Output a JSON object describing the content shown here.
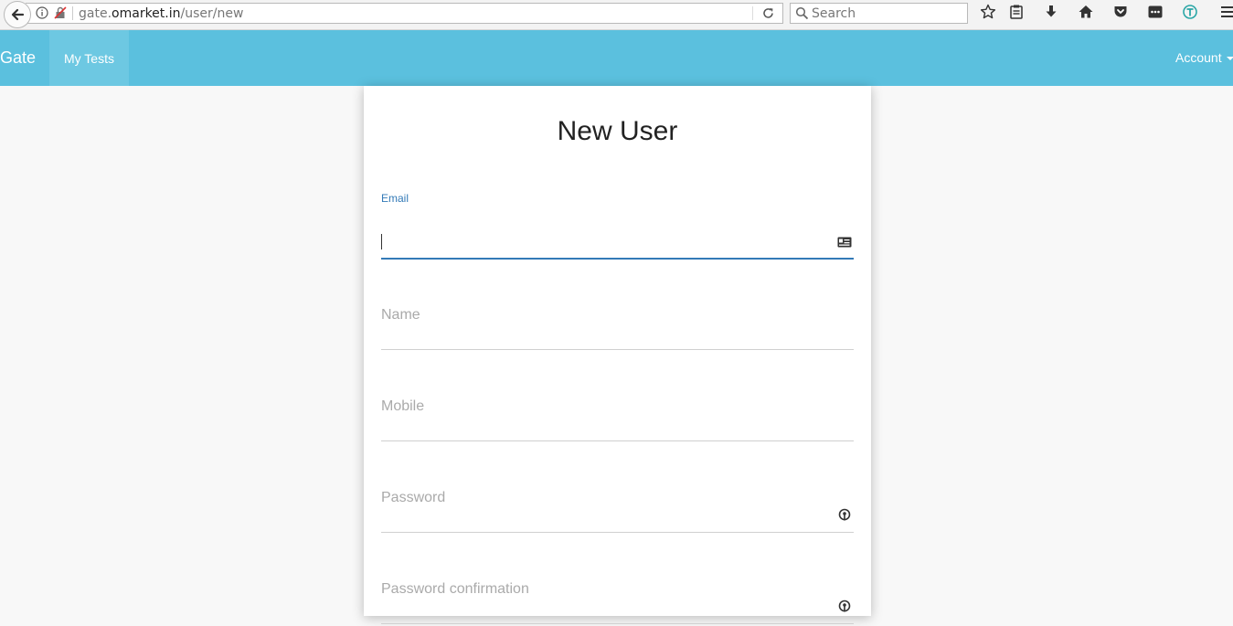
{
  "browser": {
    "url_prefix": "gate.",
    "url_host": "omarket.in",
    "url_path": "/user/new",
    "search_placeholder": "Search"
  },
  "navbar": {
    "brand": "Gate",
    "my_tests": "My Tests",
    "account": "Account"
  },
  "form": {
    "title": "New User",
    "fields": [
      {
        "label": "Email",
        "value": "",
        "icon": "contact-card-icon",
        "active": true
      },
      {
        "label": "Name",
        "value": ""
      },
      {
        "label": "Mobile",
        "value": ""
      },
      {
        "label": "Password",
        "value": "",
        "icon": "key-icon"
      },
      {
        "label": "Password confirmation",
        "value": "",
        "icon": "key-icon"
      }
    ]
  },
  "colors": {
    "navbar": "#5bc0de",
    "navbar_active": "#6dc8e2",
    "accent": "#337ab7",
    "page_bg": "#f8f8f8"
  }
}
